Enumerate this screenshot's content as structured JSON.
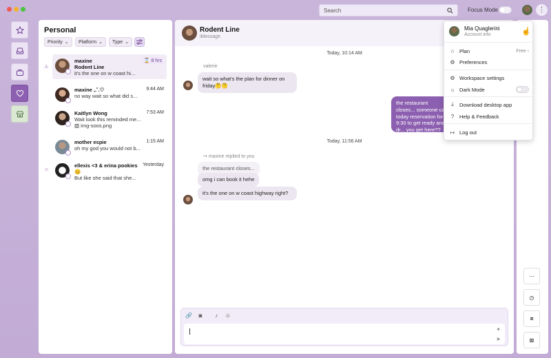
{
  "topbar": {
    "search_placeholder": "Search",
    "focus_mode_label": "Focus Mode",
    "more_label": "⋮"
  },
  "sidebar_title": "Personal",
  "filters": [
    {
      "label": "Priority"
    },
    {
      "label": "Platform"
    },
    {
      "label": "Type"
    }
  ],
  "conversations": [
    {
      "name": "maxine",
      "subtitle": "Rodent Line",
      "preview": "it's the one on w coast hi...",
      "time": "8 hrs",
      "selected": true
    },
    {
      "name": "maxine ,.˚.♡",
      "preview": "no way wait so what did s...",
      "time": "9:44 AM"
    },
    {
      "name": "Kaitlyn Wong",
      "preview": "Wait look this reminded me...",
      "attachment": "img-soos.png",
      "time": "7:53 AM"
    },
    {
      "name": "mother espie",
      "preview": "oh my god you would not b...",
      "time": "1:15 AM"
    },
    {
      "name": "ellexis <3 & erina pookies 😊",
      "preview": "But like she said that she...",
      "time": "Yesterday"
    }
  ],
  "chat": {
    "title": "Rodent Line",
    "service": "iMessage",
    "timestamp1": "Today, 10:14 AM",
    "timestamp2": "Today, 11:56 AM",
    "sender1": "valerie",
    "msg1": "wait so what's the plan for dinner on friday🤔🤔",
    "msg_out": "the restaurant closes... someone call today reservation for 9:30 to get ready and dr... you get here??",
    "reply_note": "maxine replied to you",
    "quoted": "the restaurant closes...",
    "msg2": "omg i can book it hehe",
    "msg3": "it's the one on w coast highway right?"
  },
  "menu": {
    "account_name": "Mia Quaglerini",
    "account_sub": "Account info",
    "items": [
      {
        "label": "Plan",
        "right": "Free"
      },
      {
        "label": "Preferences"
      },
      {
        "label": "Workspace settings"
      },
      {
        "label": "Dark Mode"
      },
      {
        "label": "Download desktop app"
      },
      {
        "label": "Help & Feedback"
      },
      {
        "label": "Log out"
      }
    ]
  },
  "colors": {
    "accent": "#8c5fb0",
    "window_bg": "#c7b3d9"
  }
}
